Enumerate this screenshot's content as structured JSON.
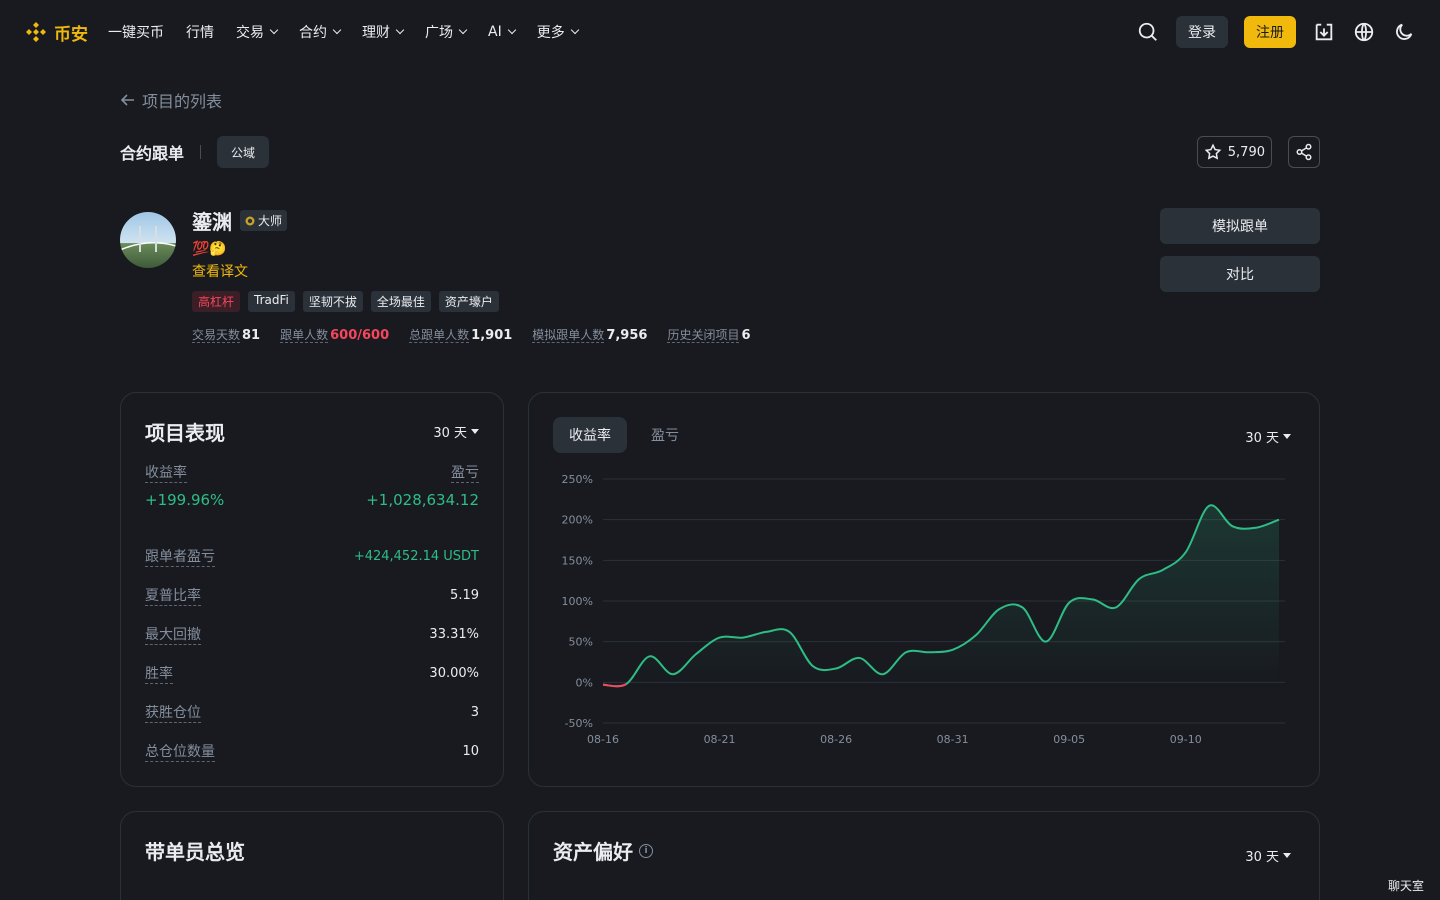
{
  "header": {
    "logo_text": "币安",
    "nav": [
      {
        "label": "一键买币",
        "dropdown": false
      },
      {
        "label": "行情",
        "dropdown": false
      },
      {
        "label": "交易",
        "dropdown": true
      },
      {
        "label": "合约",
        "dropdown": true
      },
      {
        "label": "理财",
        "dropdown": true
      },
      {
        "label": "广场",
        "dropdown": true
      },
      {
        "label": "AI",
        "dropdown": true
      },
      {
        "label": "更多",
        "dropdown": true
      }
    ],
    "login_label": "登录",
    "signup_label": "注册"
  },
  "back_label": "项目的列表",
  "title_row": {
    "title": "合约跟单",
    "chip": "公域",
    "favorites": "5,790"
  },
  "profile": {
    "name": "鎏渊",
    "badge": "大师",
    "emoji": "💯🤔",
    "translate": "查看译文",
    "tags": [
      {
        "label": "高杠杆",
        "style": "red"
      },
      {
        "label": "TradFi",
        "style": "normal"
      },
      {
        "label": "坚韧不拔",
        "style": "normal"
      },
      {
        "label": "全场最佳",
        "style": "normal"
      },
      {
        "label": "资产壕户",
        "style": "normal"
      }
    ],
    "stats": [
      {
        "label": "交易天数",
        "value": "81",
        "highlight": false
      },
      {
        "label": "跟单人数",
        "value": "600/600",
        "highlight": true
      },
      {
        "label": "总跟单人数",
        "value": "1,901",
        "highlight": false
      },
      {
        "label": "模拟跟单人数",
        "value": "7,956",
        "highlight": false
      },
      {
        "label": "历史关闭项目",
        "value": "6",
        "highlight": false
      }
    ],
    "copy_button": "模拟跟单",
    "compare_button": "对比"
  },
  "performance": {
    "title": "项目表现",
    "range": "30 天",
    "roi_label": "收益率",
    "pnl_label": "盈亏",
    "roi_value": "+199.96%",
    "pnl_value": "+1,028,634.12",
    "rows": [
      {
        "label": "跟单者盈亏",
        "value": "+424,452.14 USDT",
        "green": true
      },
      {
        "label": "夏普比率",
        "value": "5.19",
        "green": false
      },
      {
        "label": "最大回撤",
        "value": "33.31%",
        "green": false
      },
      {
        "label": "胜率",
        "value": "30.00%",
        "green": false
      },
      {
        "label": "获胜仓位",
        "value": "3",
        "green": false
      },
      {
        "label": "总仓位数量",
        "value": "10",
        "green": false
      }
    ]
  },
  "chart_card": {
    "tab_roi": "收益率",
    "tab_pnl": "盈亏",
    "range": "30 天"
  },
  "chart_data": {
    "type": "area",
    "title": "",
    "xlabel": "",
    "ylabel": "",
    "ylim": [
      -50,
      250
    ],
    "y_ticks": [
      "250%",
      "200%",
      "150%",
      "100%",
      "50%",
      "0%",
      "-50%"
    ],
    "x_ticks": [
      "08-16",
      "08-21",
      "08-26",
      "08-31",
      "09-05",
      "09-10"
    ],
    "grid": true,
    "line_color": "#2ebd85",
    "negative_color": "#f6465d",
    "series": [
      {
        "x": [
          "08-16",
          "08-17",
          "08-18",
          "08-19",
          "08-20",
          "08-21",
          "08-22",
          "08-23",
          "08-24",
          "08-25",
          "08-26",
          "08-27",
          "08-28",
          "08-29",
          "08-30",
          "08-31",
          "09-01",
          "09-02",
          "09-03",
          "09-04",
          "09-05",
          "09-06",
          "09-07",
          "09-08",
          "09-09",
          "09-10",
          "09-11",
          "09-12",
          "09-13",
          "09-14"
        ],
        "values": [
          -3,
          -2,
          32,
          10,
          35,
          55,
          55,
          62,
          62,
          20,
          17,
          30,
          10,
          37,
          37,
          40,
          58,
          90,
          92,
          50,
          98,
          102,
          92,
          127,
          138,
          160,
          217,
          192,
          190,
          200
        ]
      }
    ]
  },
  "bottom": {
    "left_title": "带单员总览",
    "right_title": "资产偏好",
    "right_range": "30 天"
  },
  "chatroom": "聊天室"
}
